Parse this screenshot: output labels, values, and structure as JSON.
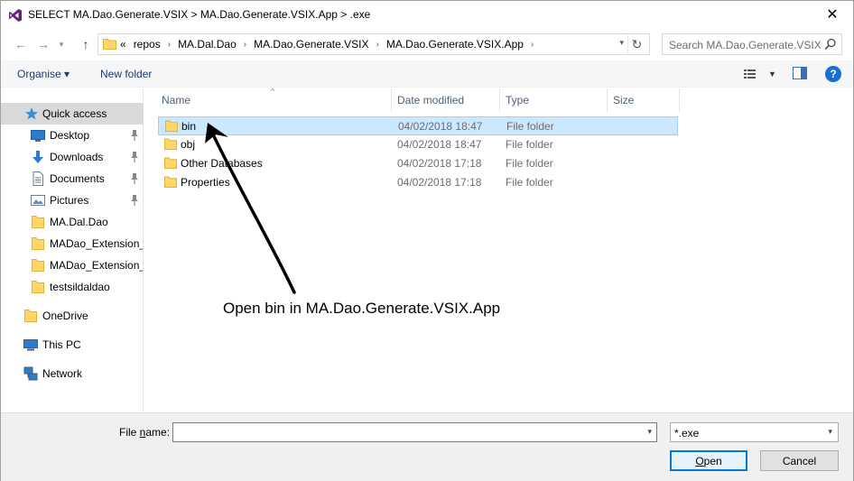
{
  "window": {
    "title": "SELECT MA.Dao.Generate.VSIX > MA.Dao.Generate.VSIX.App > .exe",
    "close_glyph": "✕"
  },
  "address": {
    "overflow": "«",
    "crumbs": [
      "repos",
      "MA.Dal.Dao",
      "MA.Dao.Generate.VSIX",
      "MA.Dao.Generate.VSIX.App"
    ],
    "separator": "›",
    "search_placeholder": "Search MA.Dao.Generate.VSIX.App"
  },
  "toolbar": {
    "organise_label": "Organise ▾",
    "new_folder_label": "New folder"
  },
  "navpane": {
    "items": [
      {
        "label": "Quick access",
        "icon": "star-icon",
        "selected": true
      },
      {
        "label": "Desktop",
        "icon": "desktop-icon",
        "pinned": true
      },
      {
        "label": "Downloads",
        "icon": "download-icon",
        "pinned": true
      },
      {
        "label": "Documents",
        "icon": "documents-icon",
        "pinned": true
      },
      {
        "label": "Pictures",
        "icon": "pictures-icon",
        "pinned": true
      },
      {
        "label": "MA.Dal.Dao",
        "icon": "folder-icon"
      },
      {
        "label": "MADao_Extension_I",
        "icon": "folder-icon"
      },
      {
        "label": "MADao_Extension_I",
        "icon": "folder-icon"
      },
      {
        "label": "testsildaldao",
        "icon": "folder-icon"
      },
      {
        "label": "OneDrive",
        "icon": "folder-icon"
      },
      {
        "label": "This PC",
        "icon": "computer-icon"
      },
      {
        "label": "Network",
        "icon": "network-icon"
      }
    ]
  },
  "filelist": {
    "columns": [
      "Name",
      "Date modified",
      "Type",
      "Size"
    ],
    "rows": [
      {
        "name": "bin",
        "date": "04/02/2018 18:47",
        "type": "File folder",
        "selected": true
      },
      {
        "name": "obj",
        "date": "04/02/2018 18:47",
        "type": "File folder"
      },
      {
        "name": "Other Databases",
        "date": "04/02/2018 17:18",
        "type": "File folder"
      },
      {
        "name": "Properties",
        "date": "04/02/2018 17:18",
        "type": "File folder"
      }
    ]
  },
  "annotation": {
    "text": "Open bin in MA.Dao.Generate.VSIX.App"
  },
  "bottom": {
    "file_name_label_pre": "File ",
    "file_name_label_u": "n",
    "file_name_label_post": "ame:",
    "file_name_value": "",
    "filter_value": "*.exe",
    "open_label_u": "O",
    "open_label_post": "pen",
    "cancel_label": "Cancel"
  },
  "colors": {
    "selection_bg": "#cce8ff",
    "selection_border": "#99d1ff",
    "link_blue": "#1e3a6e",
    "folder_yellow": "#ffd766",
    "accent": "#0078d7"
  }
}
